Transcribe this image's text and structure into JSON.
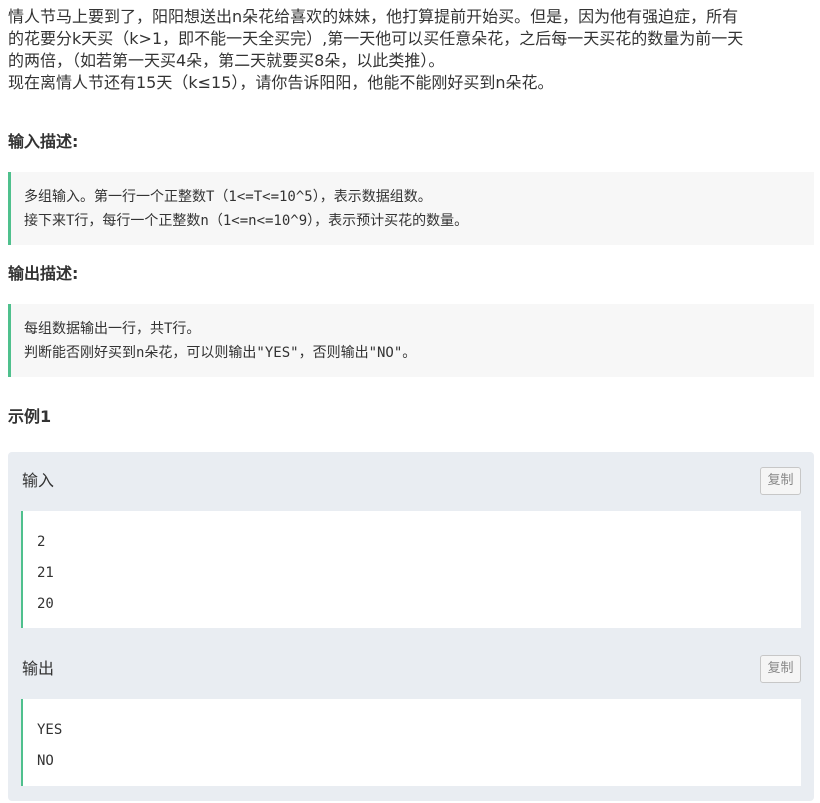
{
  "problem": {
    "description_lines": [
      "情人节马上要到了，阳阳想送出n朵花给喜欢的妹妹，他打算提前开始买。但是，因为他有强迫症，所有",
      "的花要分k天买（k>1，即不能一天全买完）,第一天他可以买任意朵花，之后每一天买花的数量为前一天",
      "的两倍，（如若第一天买4朵，第二天就要买8朵，以此类推）。",
      "现在离情人节还有15天（k≤15），请你告诉阳阳，他能不能刚好买到n朵花。"
    ]
  },
  "input_section": {
    "title": "输入描述:",
    "lines": [
      "多组输入。第一行一个正整数T（1<=T<=10^5），表示数据组数。",
      "接下来T行，每行一个正整数n（1<=n<=10^9），表示预计买花的数量。"
    ]
  },
  "output_section": {
    "title": "输出描述:",
    "lines": [
      "每组数据输出一行，共T行。",
      "判断能否刚好买到n朵花，可以则输出\"YES\"，否则输出\"NO\"。"
    ]
  },
  "example": {
    "title": "示例1",
    "input_label": "输入",
    "output_label": "输出",
    "copy_label": "复制",
    "input_lines": [
      "2",
      "21",
      "20"
    ],
    "output_lines": [
      "YES",
      "NO"
    ]
  },
  "colors": {
    "accent": "#4fc08d",
    "panel_bg": "#e9edf2",
    "quote_bg": "#f7f7f7"
  }
}
